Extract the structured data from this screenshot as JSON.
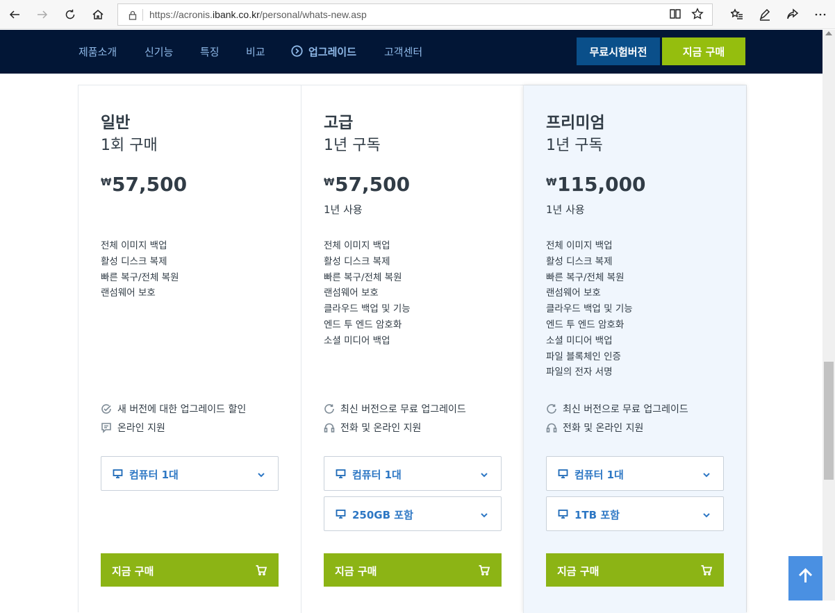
{
  "browser": {
    "url_prefix": "https://acronis.",
    "url_host": "ibank.co.kr",
    "url_path": "/personal/whats-new.asp"
  },
  "nav": {
    "items": [
      "제품소개",
      "신기능",
      "특징",
      "비교",
      "업그레이드",
      "고객센터"
    ],
    "active_index": 4,
    "trial_button": "무료시험버전",
    "buy_button": "지금 구매"
  },
  "currency_symbol": "₩",
  "plans": [
    {
      "name": "일반",
      "term": "1회 구매",
      "price": "57,500",
      "usage": "",
      "features": [
        "전체 이미지 백업",
        "활성 디스크 복제",
        "빠른 복구/전체 복원",
        "랜섬웨어 보호"
      ],
      "benefits": [
        {
          "icon": "check-circle-icon",
          "text": "새 버전에 대한 업그레이드 할인"
        },
        {
          "icon": "chat-icon",
          "text": "온라인 지원"
        }
      ],
      "selects": [
        {
          "icon": "monitor-icon",
          "label": "컴퓨터 1대"
        }
      ],
      "buy_label": "지금 구매"
    },
    {
      "name": "고급",
      "term": "1년 구독",
      "price": "57,500",
      "usage": "1년 사용",
      "features": [
        "전체 이미지 백업",
        "활성 디스크 복제",
        "빠른 복구/전체 복원",
        "랜섬웨어 보호",
        "클라우드 백업 및 기능",
        "엔드 투 엔드 암호화",
        "소셜 미디어 백업"
      ],
      "benefits": [
        {
          "icon": "refresh-icon",
          "text": "최신 버전으로 무료 업그레이드"
        },
        {
          "icon": "headset-icon",
          "text": "전화 및 온라인 지원"
        }
      ],
      "selects": [
        {
          "icon": "monitor-icon",
          "label": "컴퓨터 1대"
        },
        {
          "icon": "monitor-icon",
          "label": "250GB 포함"
        }
      ],
      "buy_label": "지금 구매"
    },
    {
      "name": "프리미엄",
      "term": "1년 구독",
      "price": "115,000",
      "usage": "1년 사용",
      "features": [
        "전체 이미지 백업",
        "활성 디스크 복제",
        "빠른 복구/전체 복원",
        "랜섬웨어 보호",
        "클라우드 백업 및 기능",
        "엔드 투 엔드 암호화",
        "소셜 미디어 백업",
        "파일 블록체인 인증",
        "파일의 전자 서명"
      ],
      "benefits": [
        {
          "icon": "refresh-icon",
          "text": "최신 버전으로 무료 업그레이드"
        },
        {
          "icon": "headset-icon",
          "text": "전화 및 온라인 지원"
        }
      ],
      "selects": [
        {
          "icon": "monitor-icon",
          "label": "컴퓨터 1대"
        },
        {
          "icon": "monitor-icon",
          "label": "1TB 포함"
        }
      ],
      "buy_label": "지금 구매"
    }
  ],
  "colors": {
    "nav_bg": "#021636",
    "nav_text": "#8fb9e8",
    "trial_bg": "#0a4f8a",
    "buy_bg": "#8cb415",
    "premium_bg": "#f0f6fd",
    "select_text": "#2d77c4",
    "to_top_bg": "#4a90e2"
  }
}
